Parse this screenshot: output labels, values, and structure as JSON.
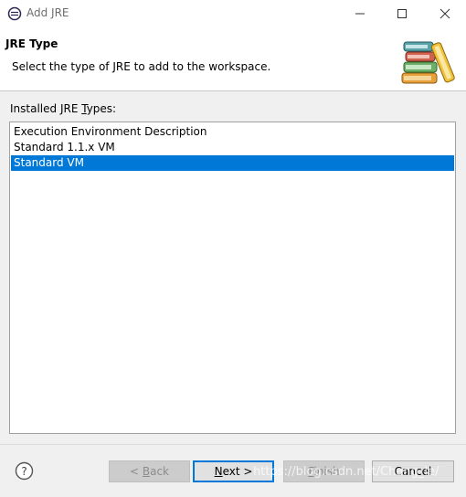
{
  "window": {
    "title": "Add JRE",
    "controls": [
      "minimize-icon",
      "maximize-icon",
      "close-icon"
    ]
  },
  "banner": {
    "title": "JRE Type",
    "description": "Select the type of JRE to add to the workspace.",
    "image": "books-icon"
  },
  "list": {
    "label_prefix": "Installed JRE ",
    "label_mnemonic": "T",
    "label_suffix": "ypes:",
    "items": [
      {
        "label": "Execution Environment Description",
        "selected": false
      },
      {
        "label": "Standard 1.1.x VM",
        "selected": false
      },
      {
        "label": "Standard VM",
        "selected": true
      }
    ]
  },
  "buttons": {
    "help_icon": "help-icon",
    "back_prefix": "< ",
    "back_mnemonic": "B",
    "back_suffix": "ack",
    "next_mnemonic": "N",
    "next_suffix": "ext >",
    "finish_mnemonic": "F",
    "finish_suffix": "inish",
    "cancel": "Cancel"
  },
  "watermark": "https://blog.csdn.net/Chang_le/",
  "colors": {
    "selection": "#0078d7",
    "dialog_bg": "#f0f0f0",
    "default_button_border": "#0078d7"
  }
}
